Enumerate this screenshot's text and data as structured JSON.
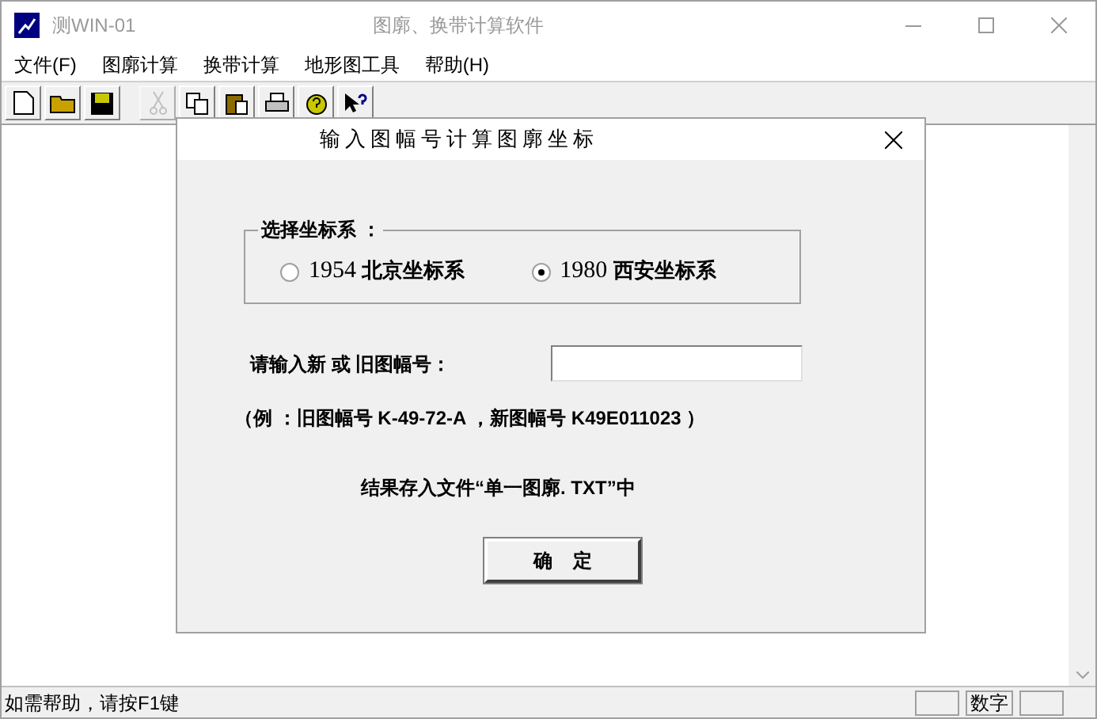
{
  "window": {
    "title_left": "测WIN-01",
    "title": "图廓、换带计算软件"
  },
  "menu": [
    "文件(F)",
    "图廓计算",
    "换带计算",
    "地形图工具",
    "帮助(H)"
  ],
  "toolbar": [
    {
      "kind": "new",
      "disabled": false
    },
    {
      "kind": "open",
      "disabled": false
    },
    {
      "kind": "save",
      "disabled": false
    },
    {
      "kind": "sep"
    },
    {
      "kind": "cut",
      "disabled": true
    },
    {
      "kind": "copy",
      "disabled": false
    },
    {
      "kind": "paste",
      "disabled": false
    },
    {
      "kind": "print",
      "disabled": false
    },
    {
      "kind": "about",
      "disabled": false
    },
    {
      "kind": "help",
      "disabled": false
    }
  ],
  "dialog": {
    "title": "输入图幅号计算图廓坐标",
    "group_label": "选择坐标系   ：",
    "options": [
      {
        "year": "1954",
        "label": "北京坐标系",
        "selected": false
      },
      {
        "year": "1980",
        "label": "西安坐标系",
        "selected": true
      }
    ],
    "input_label": "请输入新 或 旧图幅号：",
    "example": "（例 ：旧图幅号  K-49-72-A ，新图幅号  K49E011023 ）",
    "note": "结果存入文件“单一图廓. TXT”中",
    "ok": "确    定"
  },
  "status_bar": {
    "text": "如需帮助，请按F1键",
    "num": "数字"
  }
}
